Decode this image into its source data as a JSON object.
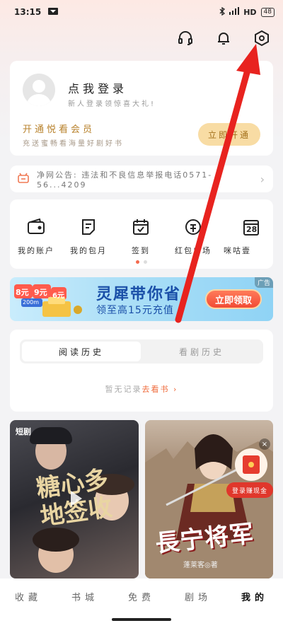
{
  "status_bar": {
    "time": "13:15",
    "network": "HD",
    "battery": "48"
  },
  "header": {
    "icons": [
      "headset-icon",
      "bell-icon",
      "settings-hex-icon"
    ]
  },
  "login": {
    "title": "点我登录",
    "subtitle": "新人登录领惊喜大礼!",
    "vip_title": "开通悦看会员",
    "vip_subtitle": "充送蜜畅看海量好剧好书",
    "vip_button": "立即开通"
  },
  "notice": {
    "text": "净网公告: 违法和不良信息举报电话0571-56...4209"
  },
  "quick_menu": {
    "items": [
      {
        "label": "我的账户",
        "icon": "wallet-icon"
      },
      {
        "label": "我的包月",
        "icon": "document-icon"
      },
      {
        "label": "签到",
        "icon": "calendar-check-icon"
      },
      {
        "label": "红包广场",
        "icon": "coin-icon"
      },
      {
        "label": "咪咕壹",
        "icon": "calendar-28-icon"
      }
    ],
    "calendar_day": "28"
  },
  "banner": {
    "headline": "灵犀带你省",
    "subline": "领至高15元充值",
    "cta": "立即领取",
    "ad": "广告",
    "coupons": [
      "8元",
      "9元",
      "6元",
      "200m"
    ]
  },
  "history": {
    "tab_active": "阅读历史",
    "tab_inactive": "看剧历史",
    "empty_text": "暂无记录",
    "empty_link": "去看书"
  },
  "thumbs": [
    {
      "tag": "短剧",
      "title": "糖心多地签收"
    },
    {
      "title": "長宁将军",
      "author": "蓬莱客◎著",
      "promo": "登录赚现金"
    }
  ],
  "tabbar": {
    "items": [
      "收藏",
      "书城",
      "免费",
      "剧场",
      "我的"
    ],
    "active": "我的"
  },
  "colors": {
    "accent": "#f46a4e",
    "gold": "#b8822c",
    "arrow": "#e8231f"
  }
}
